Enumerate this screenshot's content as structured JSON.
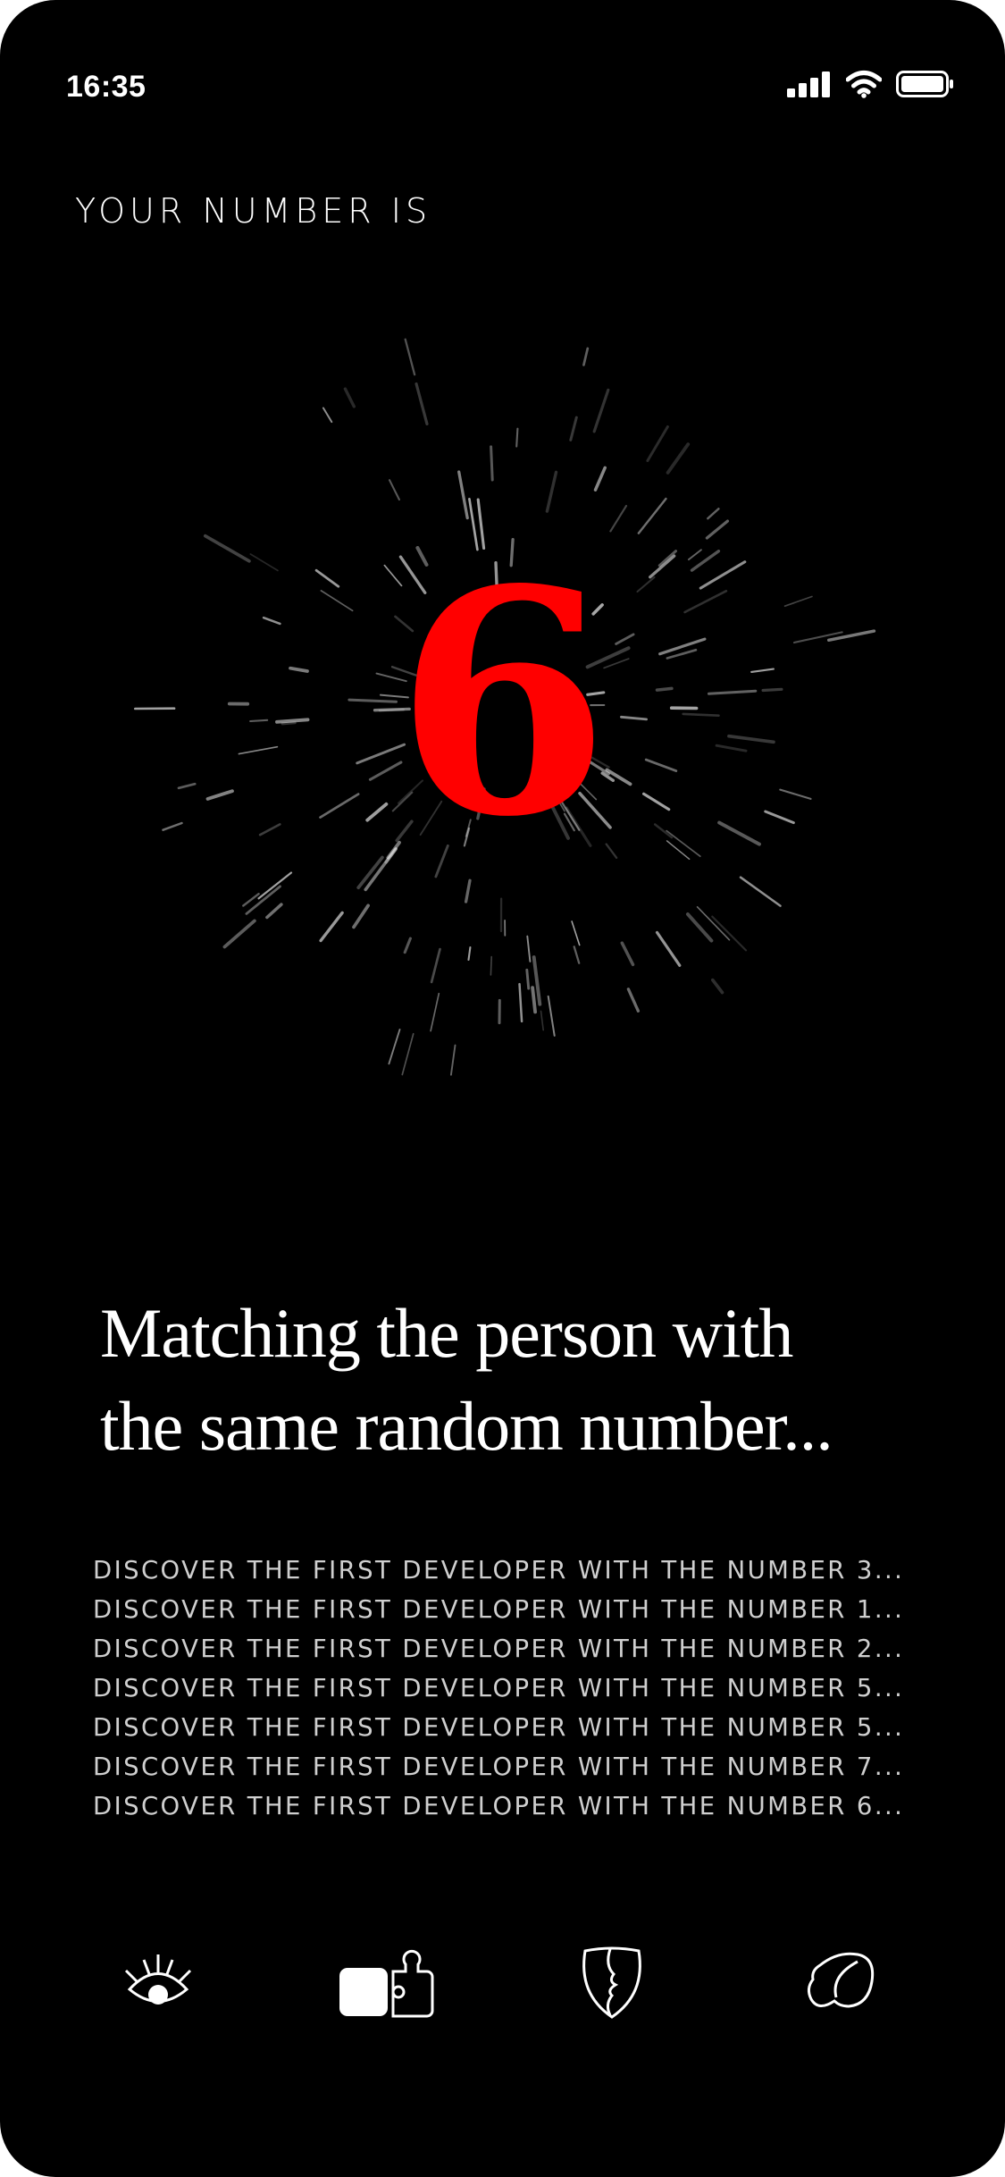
{
  "status_bar": {
    "time": "16:35",
    "icons": [
      "signal-icon",
      "wifi-icon",
      "battery-icon"
    ]
  },
  "kicker": "YOUR NUMBER IS",
  "number": "6",
  "number_color": "#ff0000",
  "headline": {
    "line1": "Matching the person with",
    "line2": "the same random number..."
  },
  "log": [
    "DISCOVER THE FIRST DEVELOPER WITH THE NUMBER 3...",
    "DISCOVER THE FIRST DEVELOPER WITH THE NUMBER 1...",
    "DISCOVER THE FIRST DEVELOPER WITH THE NUMBER 2...",
    "DISCOVER THE FIRST DEVELOPER WITH THE NUMBER 5...",
    "DISCOVER THE FIRST DEVELOPER WITH THE NUMBER 5...",
    "DISCOVER THE FIRST DEVELOPER WITH THE NUMBER 7...",
    "DISCOVER THE FIRST DEVELOPER WITH THE NUMBER 6..."
  ],
  "tabbar": {
    "icons": [
      "eye-icon",
      "puzzle-icon",
      "shield-face-icon",
      "cell-icon"
    ]
  }
}
